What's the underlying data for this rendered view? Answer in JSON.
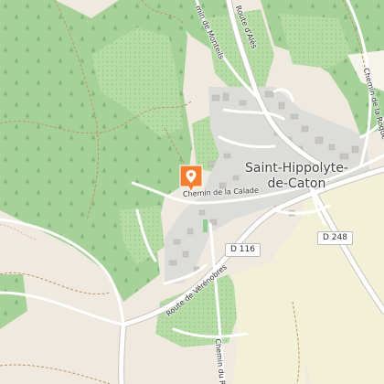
{
  "map": {
    "place_name_line1": "Saint-Hippolyte-",
    "place_name_line2": "de-Caton",
    "roads": {
      "chemin_de_la_calade": "Chemin de la Calade",
      "route_de_verenobres": "Route de Vérénobres",
      "chemin_de_monteils": "min de Monteils",
      "route_dales": "Route d'Alès",
      "chemin_de_la_roque": "Chemin de la Roque",
      "chemin_du_ra": "Chemin du Ra"
    },
    "route_shields": {
      "d116": "D 116",
      "d248": "D 248"
    },
    "marker_icon": "map-pin-icon",
    "colors": {
      "forest": "#a9d39c",
      "vineyard": "#b5d9a6",
      "urban": "#d9dad8",
      "crop": "#f3f2d9",
      "background": "#efe9df",
      "marker": "#f47d30",
      "road": "#ffffff",
      "path": "#b98b55"
    }
  }
}
